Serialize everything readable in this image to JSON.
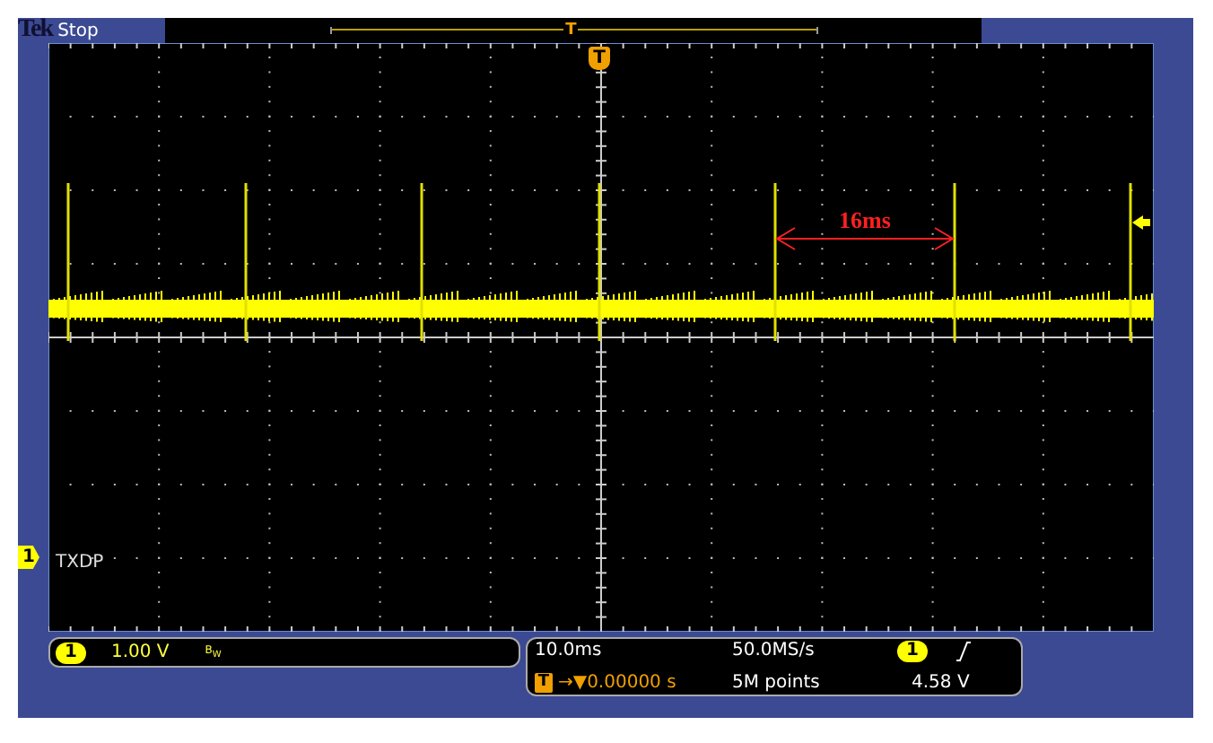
{
  "header": {
    "brand": "Tek",
    "status": "Stop"
  },
  "record_bar": {
    "marker": "T"
  },
  "trigger_marker": "T",
  "channel": {
    "number": "1",
    "label": "TXDP"
  },
  "annotation": {
    "text": "16ms"
  },
  "vertical_readout": {
    "channel": "1",
    "scale": "1.00 V",
    "bandwidth": "B$_{W}$"
  },
  "horizontal_readout": {
    "scale": "10.0ms",
    "sample_rate": "50.0MS/s",
    "trigger_icon": "T",
    "position": "→▼0.00000 s",
    "record_length": "5M points"
  },
  "trigger_readout": {
    "channel": "1",
    "level": "4.58 V"
  }
}
